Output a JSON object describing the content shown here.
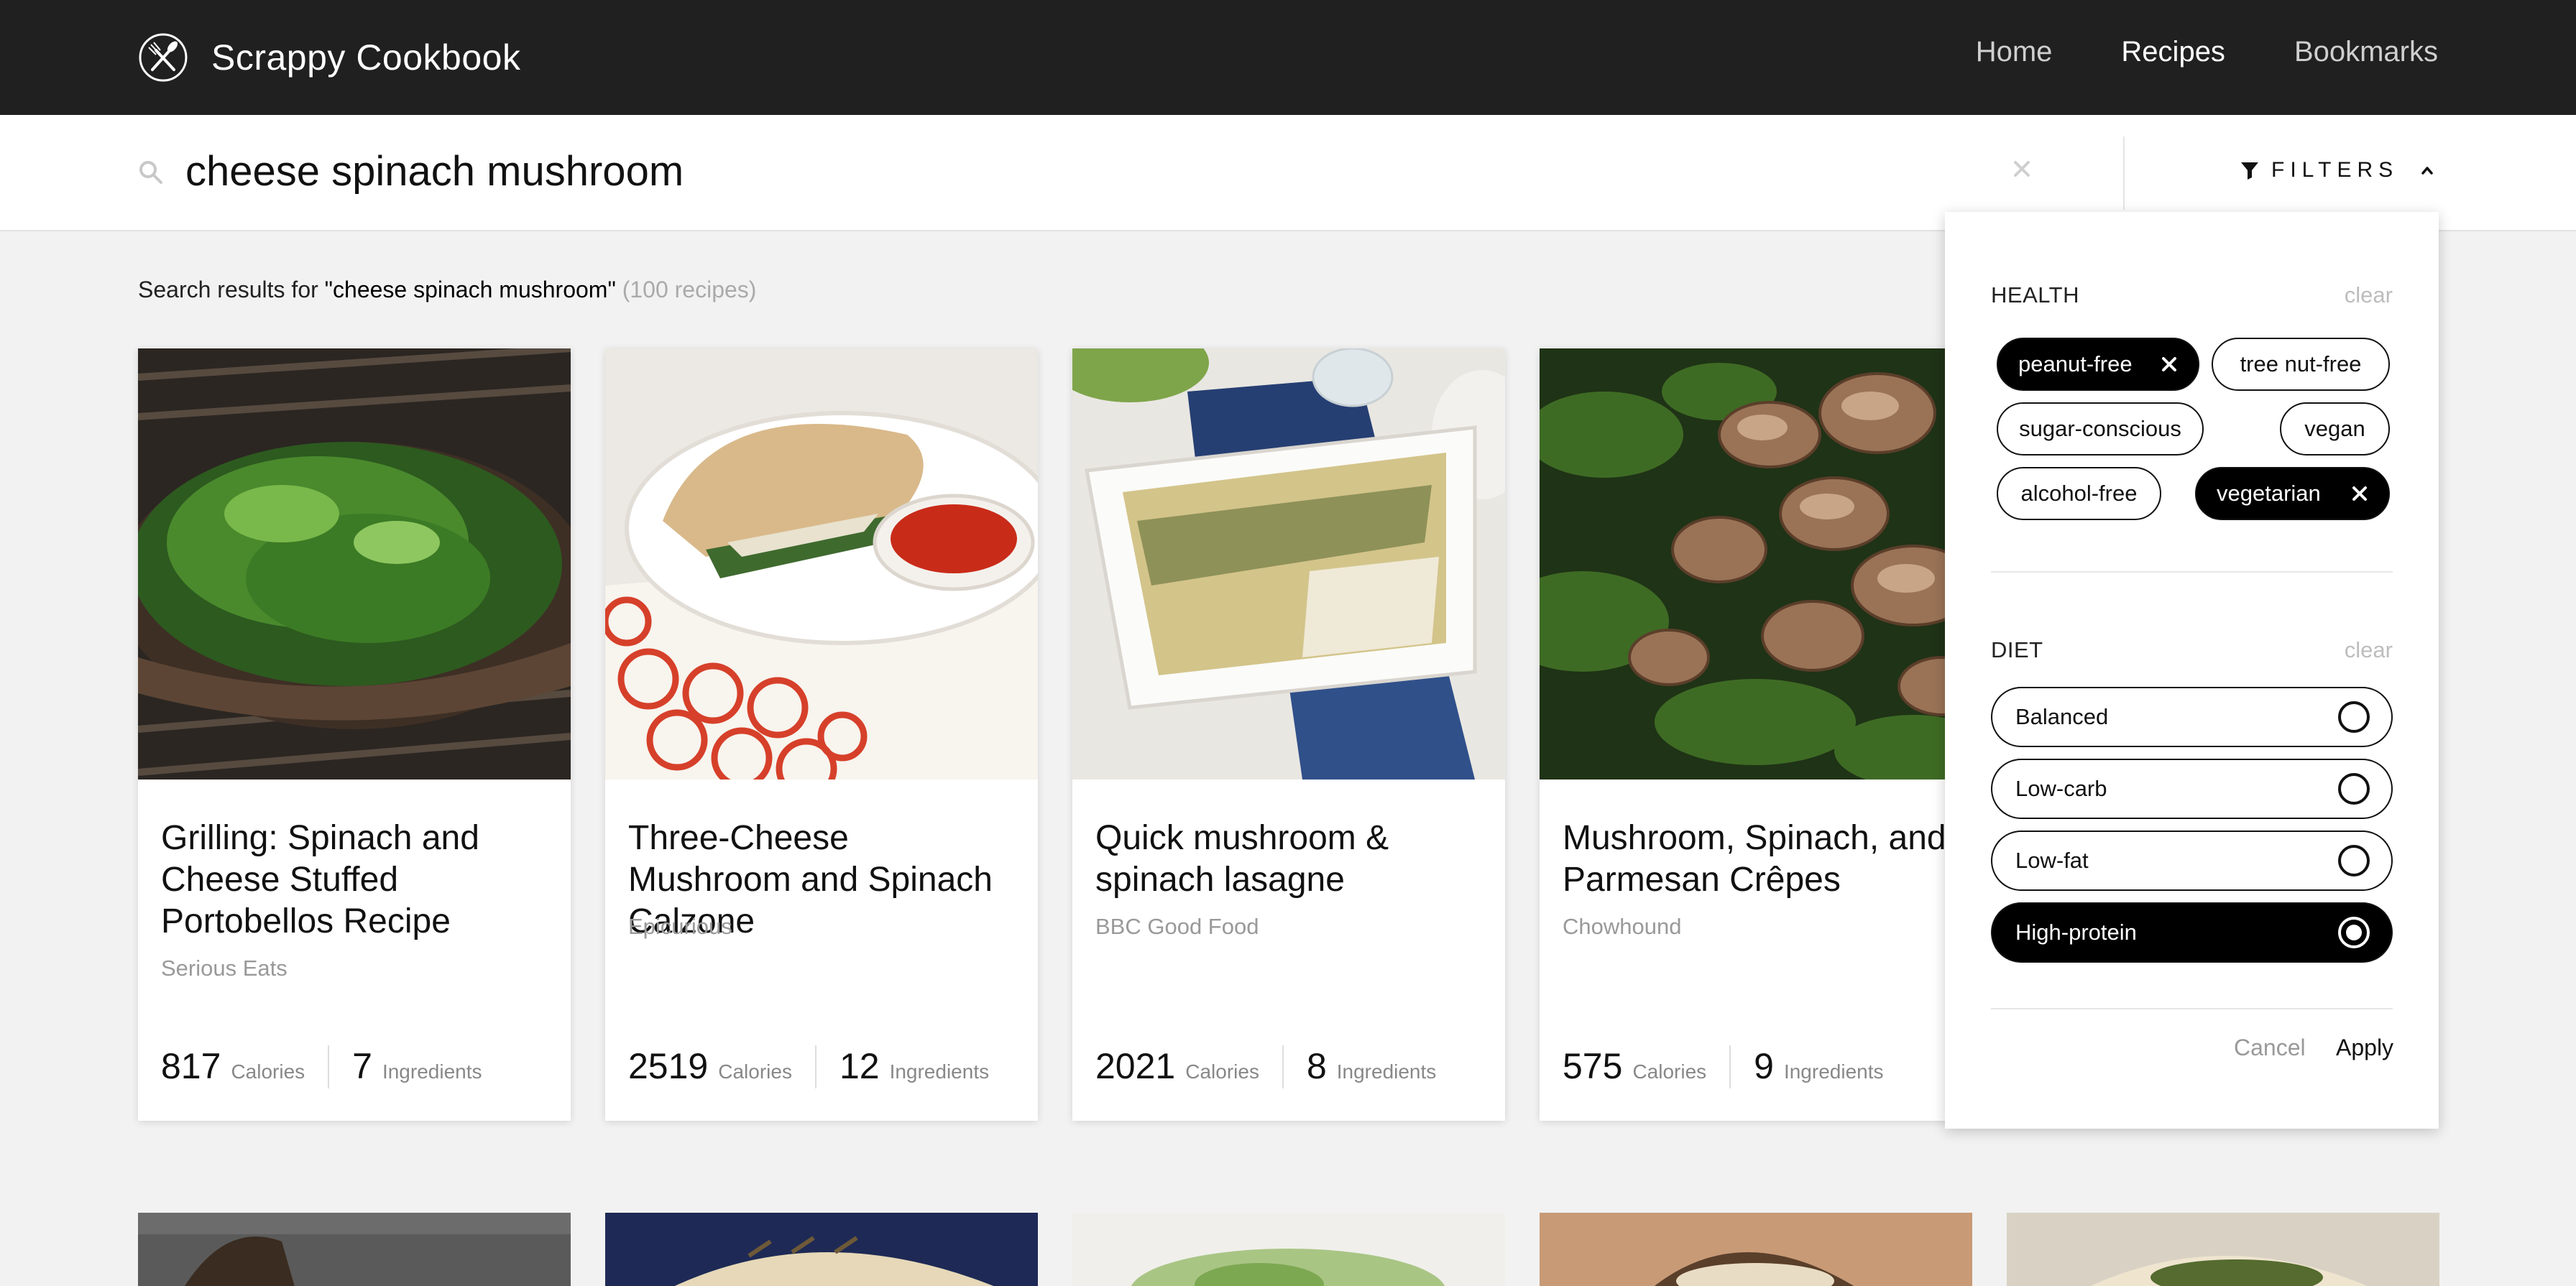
{
  "header": {
    "app_title": "Scrappy Cookbook",
    "logo_icon": "fork-knife-icon",
    "nav": [
      {
        "label": "Home",
        "active": false
      },
      {
        "label": "Recipes",
        "active": true
      },
      {
        "label": "Bookmarks",
        "active": false
      }
    ]
  },
  "search": {
    "value": "cheese spinach mushroom",
    "placeholder": "",
    "filters_label": "FILTERS"
  },
  "results": {
    "prefix": "Search results for ",
    "query_quoted": "\"cheese spinach mushroom\"",
    "count_text": "(100 recipes)"
  },
  "cards": [
    {
      "title": "Grilling: Spinach and Cheese Stuffed Portobellos Recipe",
      "source": "Serious Eats",
      "calories": "817",
      "calories_label": "Calories",
      "ingredients": "7",
      "ingredients_label": "Ingredients"
    },
    {
      "title": "Three-Cheese Mushroom and Spinach Calzone",
      "source": "Epicurious",
      "calories": "2519",
      "calories_label": "Calories",
      "ingredients": "12",
      "ingredients_label": "Ingredients"
    },
    {
      "title": "Quick mushroom & spinach lasagne",
      "source": "BBC Good Food",
      "calories": "2021",
      "calories_label": "Calories",
      "ingredients": "8",
      "ingredients_label": "Ingredients"
    },
    {
      "title": "Mushroom, Spinach, and Parmesan Crêpes",
      "source": "Chowhound",
      "calories": "575",
      "calories_label": "Calories",
      "ingredients": "9",
      "ingredients_label": "Ingredients"
    }
  ],
  "filters": {
    "health": {
      "heading": "HEALTH",
      "clear": "clear",
      "chips": [
        {
          "label": "peanut-free",
          "active": true
        },
        {
          "label": "tree nut-free",
          "active": false
        },
        {
          "label": "sugar-conscious",
          "active": false
        },
        {
          "label": "vegan",
          "active": false
        },
        {
          "label": "alcohol-free",
          "active": false
        },
        {
          "label": "vegetarian",
          "active": true
        }
      ]
    },
    "diet": {
      "heading": "DIET",
      "clear": "clear",
      "options": [
        {
          "label": "Balanced",
          "selected": false
        },
        {
          "label": "Low-carb",
          "selected": false
        },
        {
          "label": "Low-fat",
          "selected": false
        },
        {
          "label": "High-protein",
          "selected": true
        }
      ]
    },
    "cancel": "Cancel",
    "apply": "Apply"
  },
  "colors": {
    "header_bg": "#202020",
    "page_bg": "#f2f2f2",
    "active_chip_bg": "#000000"
  }
}
